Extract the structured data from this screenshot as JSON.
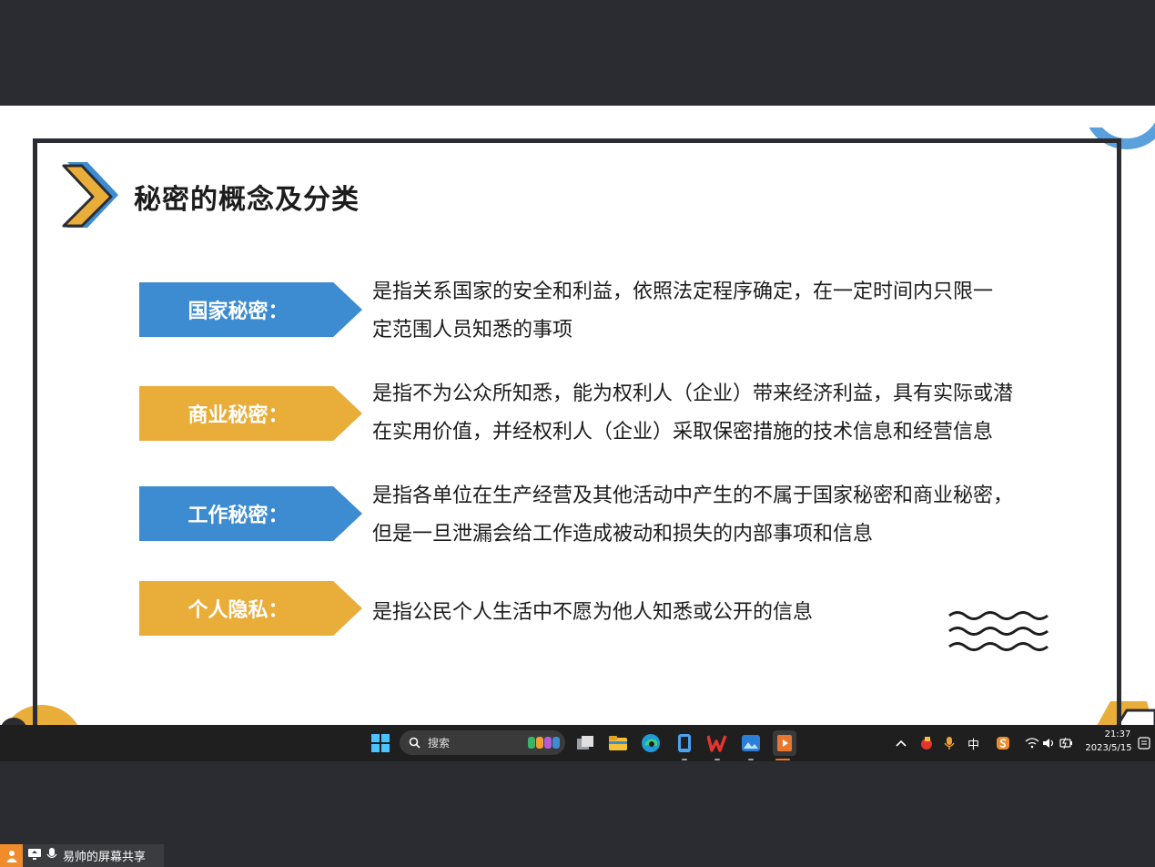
{
  "slide": {
    "title": "秘密的概念及分类",
    "rows": [
      {
        "label": "国家秘密：",
        "color": "#3d8bd1",
        "lines": [
          "是指关系国家的安全和利益，依照法定程序确定，在一定时间内只限一",
          "定范围人员知悉的事项"
        ]
      },
      {
        "label": "商业秘密：",
        "color": "#e9ad3a",
        "lines": [
          "是指不为公众所知悉，能为权利人（企业）带来经济利益，具有实际或潜",
          "在实用价值，并经权利人（企业）采取保密措施的技术信息和经营信息"
        ]
      },
      {
        "label": "工作秘密：",
        "color": "#3d8bd1",
        "lines": [
          "是指各单位在生产经营及其他活动中产生的不属于国家秘密和商业秘密，",
          "但是一旦泄漏会给工作造成被动和损失的内部事项和信息"
        ]
      },
      {
        "label": "个人隐私：",
        "color": "#e9ad3a",
        "lines": [
          "是指公民个人生活中不愿为他人知悉或公开的信息"
        ]
      }
    ]
  },
  "taskbar": {
    "search_placeholder": "搜索",
    "tray": {
      "ime": "中",
      "time": "21:37",
      "date": "2023/5/15"
    },
    "icons": [
      "windows-start-icon",
      "search-icon",
      "task-view-icon",
      "file-explorer-icon",
      "edge-icon",
      "phone-link-icon",
      "wps-icon",
      "photos-icon",
      "presentation-icon"
    ]
  },
  "share_badge": {
    "label": "易帅的屏幕共享"
  }
}
